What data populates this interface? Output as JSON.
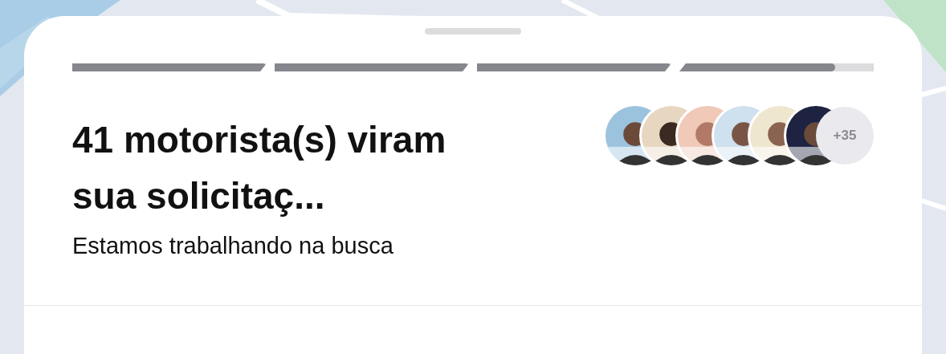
{
  "progress": {
    "segments": [
      {
        "level": 1
      },
      {
        "level": 1
      },
      {
        "level": 1
      },
      {
        "level": 0.8
      }
    ]
  },
  "title": "41 motorista(s) viram sua solicitaç...",
  "subtitle": "Estamos trabalhando na busca",
  "drivers": {
    "more": "+35"
  }
}
